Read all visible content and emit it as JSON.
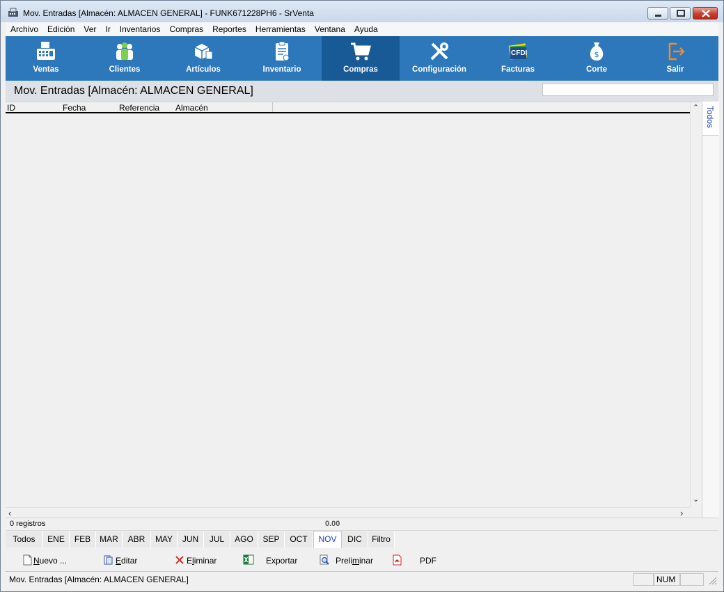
{
  "window": {
    "title": "Mov. Entradas [Almacén: ALMACEN GENERAL] - FUNK671228PH6 - SrVenta"
  },
  "menu": [
    "Archivo",
    "Edición",
    "Ver",
    "Ir",
    "Inventarios",
    "Compras",
    "Reportes",
    "Herramientas",
    "Ventana",
    "Ayuda"
  ],
  "toolbar": {
    "items": [
      {
        "label": "Ventas",
        "icon": "cash-register-icon"
      },
      {
        "label": "Clientes",
        "icon": "people-icon"
      },
      {
        "label": "Artículos",
        "icon": "boxes-icon"
      },
      {
        "label": "Inventario",
        "icon": "clipboard-icon"
      },
      {
        "label": "Compras",
        "icon": "shopping-cart-icon",
        "active": true
      },
      {
        "label": "Configuración",
        "icon": "tools-icon"
      },
      {
        "label": "Facturas",
        "icon": "cfdi-icon"
      },
      {
        "label": "Corte",
        "icon": "money-bag-icon"
      },
      {
        "label": "Salir",
        "icon": "exit-icon"
      }
    ],
    "cfdi_text": "CFDI",
    "accent": "#2d78bb",
    "active_color": "#185a95"
  },
  "header": {
    "title": "Mov. Entradas [Almacén: ALMACEN GENERAL]",
    "search_value": ""
  },
  "grid": {
    "columns": [
      "ID",
      "Fecha",
      "Referencia",
      "Almacén"
    ],
    "rows": []
  },
  "side_tab": "Todos",
  "info": {
    "count": "0 registros",
    "total": "0.00"
  },
  "months": [
    "Todos",
    "ENE",
    "FEB",
    "MAR",
    "ABR",
    "MAY",
    "JUN",
    "JUL",
    "AGO",
    "SEP",
    "OCT",
    "NOV",
    "DIC",
    "Filtro"
  ],
  "active_month": "NOV",
  "actions": {
    "nuevo": {
      "pre": "",
      "u": "N",
      "post": "uevo ..."
    },
    "editar": {
      "pre": "",
      "u": "E",
      "post": "ditar"
    },
    "eliminar": {
      "pre": "E",
      "u": "l",
      "post": "iminar"
    },
    "exportar": {
      "pre": "Exportar",
      "u": "",
      "post": ""
    },
    "preliminar": {
      "pre": "Preli",
      "u": "m",
      "post": "inar"
    },
    "pdf": {
      "pre": "PDF",
      "u": "",
      "post": ""
    }
  },
  "status": {
    "message": "Mov. Entradas [Almacén: ALMACEN GENERAL]",
    "num": "NUM"
  }
}
